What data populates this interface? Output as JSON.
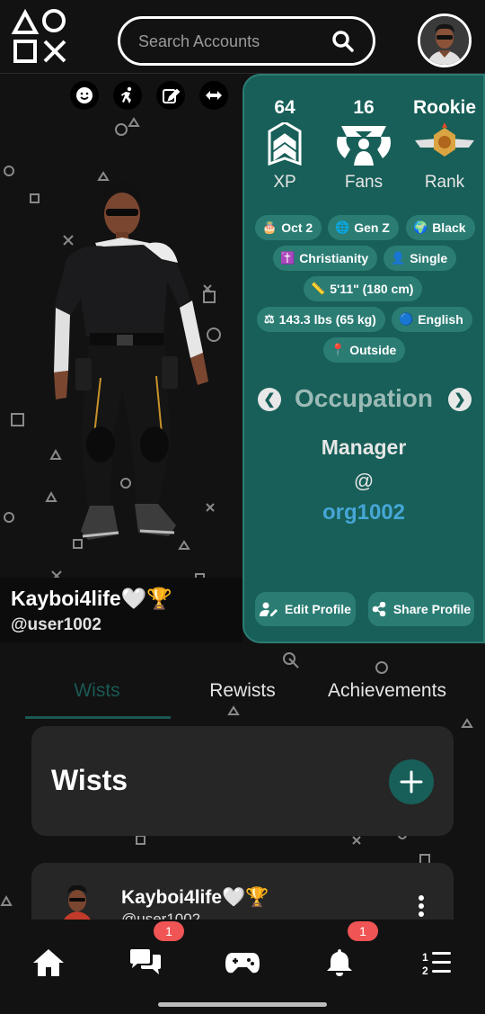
{
  "header": {
    "search_placeholder": "Search Accounts",
    "logo_icon": "playstation-shapes-icon",
    "search_icon": "search-icon"
  },
  "character": {
    "tools": [
      "emote-icon",
      "run-icon",
      "edit-icon",
      "swap-icon"
    ],
    "display_name": "Kayboi4life🤍🏆",
    "username": "@user1002"
  },
  "profile": {
    "stats": [
      {
        "value": "64",
        "label": "XP",
        "icon": "chevron-rank-icon"
      },
      {
        "value": "16",
        "label": "Fans",
        "icon": "fans-trophy-icon"
      },
      {
        "value": "Rookie",
        "label": "Rank",
        "icon": "rank-wings-icon"
      }
    ],
    "chips": [
      {
        "icon": "🎂",
        "label": "Oct 2"
      },
      {
        "icon": "🌐",
        "label": "Gen Z"
      },
      {
        "icon": "🌍",
        "label": "Black"
      },
      {
        "icon": "✝️",
        "label": "Christianity"
      },
      {
        "icon": "👤",
        "label": "Single"
      },
      {
        "icon": "📏",
        "label": "5'11\" (180 cm)"
      },
      {
        "icon": "⚖",
        "label": "143.3 lbs (65 kg)"
      },
      {
        "icon": "🔵",
        "label": "English"
      },
      {
        "icon": "📍",
        "label": "Outside"
      }
    ],
    "occupation": {
      "title": "Occupation",
      "job": "Manager",
      "at": "@",
      "org": "org1002",
      "prev": "❮",
      "next": "❯"
    },
    "edit_label": "Edit Profile",
    "share_label": "Share Profile"
  },
  "tabs": [
    {
      "label": "Wists",
      "active": true
    },
    {
      "label": "Rewists",
      "active": false
    },
    {
      "label": "Achievements",
      "active": false
    }
  ],
  "wists": {
    "title": "Wists",
    "add_icon": "plus-icon"
  },
  "post": {
    "display_name": "Kayboi4life🤍🏆",
    "username": "@user1002"
  },
  "nav": {
    "chat_badge": "1",
    "notifications_badge": "1"
  },
  "colors": {
    "accent": "#175f58",
    "accent_light": "#2b7d74",
    "link": "#46a6d6",
    "badge": "#f05454",
    "background": "#121212"
  }
}
